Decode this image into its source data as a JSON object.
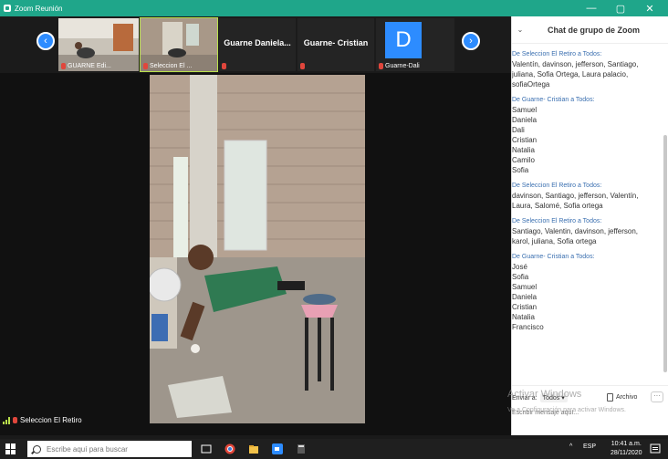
{
  "window": {
    "title": "Zoom Reunión",
    "controls": [
      "—",
      "▢",
      "✕"
    ]
  },
  "gallery": {
    "thumbnails": [
      {
        "label": "GUARNE Edi..."
      },
      {
        "label": "Seleccion El ..."
      },
      {
        "name": "Guarne  Daniela...",
        "label": ""
      },
      {
        "name": "Guarne- Cristian",
        "label": ""
      },
      {
        "avatar_letter": "D",
        "label": "Guarne-Dali"
      }
    ]
  },
  "speaker": {
    "label": "Seleccion El Retiro"
  },
  "chat": {
    "title": "Chat de grupo de Zoom",
    "messages": [
      {
        "from": "De Seleccion El Retiro a Todos:",
        "lines": [
          "Valentín, davinson, jefferson, Santiago,",
          "juliana, Sofia Ortega, Laura palacio,",
          "sofiaOrtega"
        ]
      },
      {
        "from": "De Guarne- Cristian a Todos:",
        "lines": [
          "Samuel",
          "Daniela",
          "Dali",
          "Cristian",
          "Natalia",
          "Camilo",
          "Sofia"
        ]
      },
      {
        "from": "De Seleccion El Retiro a Todos:",
        "lines": [
          "davinson, Santiago, jefferson, Valentín,",
          "Laura, Salomé, Sofia ortega"
        ]
      },
      {
        "from": "De Seleccion El Retiro a Todos:",
        "lines": [
          "Santiago, Valentin, davinson, jefferson,",
          "karol, juliana, Sofia ortega"
        ]
      },
      {
        "from": "De Guarne- Cristian a Todos:",
        "lines": [
          "José",
          "Sofia",
          "Samuel",
          "Daniela",
          "Cristian",
          "Natalia",
          "Francisco"
        ]
      }
    ],
    "send_to_label": "Enviar a:",
    "send_to_value": "Todos ▾",
    "file_label": "Archivo",
    "more_label": "···",
    "input_placeholder": "Escribir mensaje aquí..."
  },
  "watermark": {
    "line1": "Activar Windows",
    "line2": "Ve a Configuración para activar Windows."
  },
  "taskbar": {
    "search_placeholder": "Escribe aquí para buscar",
    "language": "ESP",
    "time": "10:41 a.m.",
    "date": "28/11/2020"
  }
}
